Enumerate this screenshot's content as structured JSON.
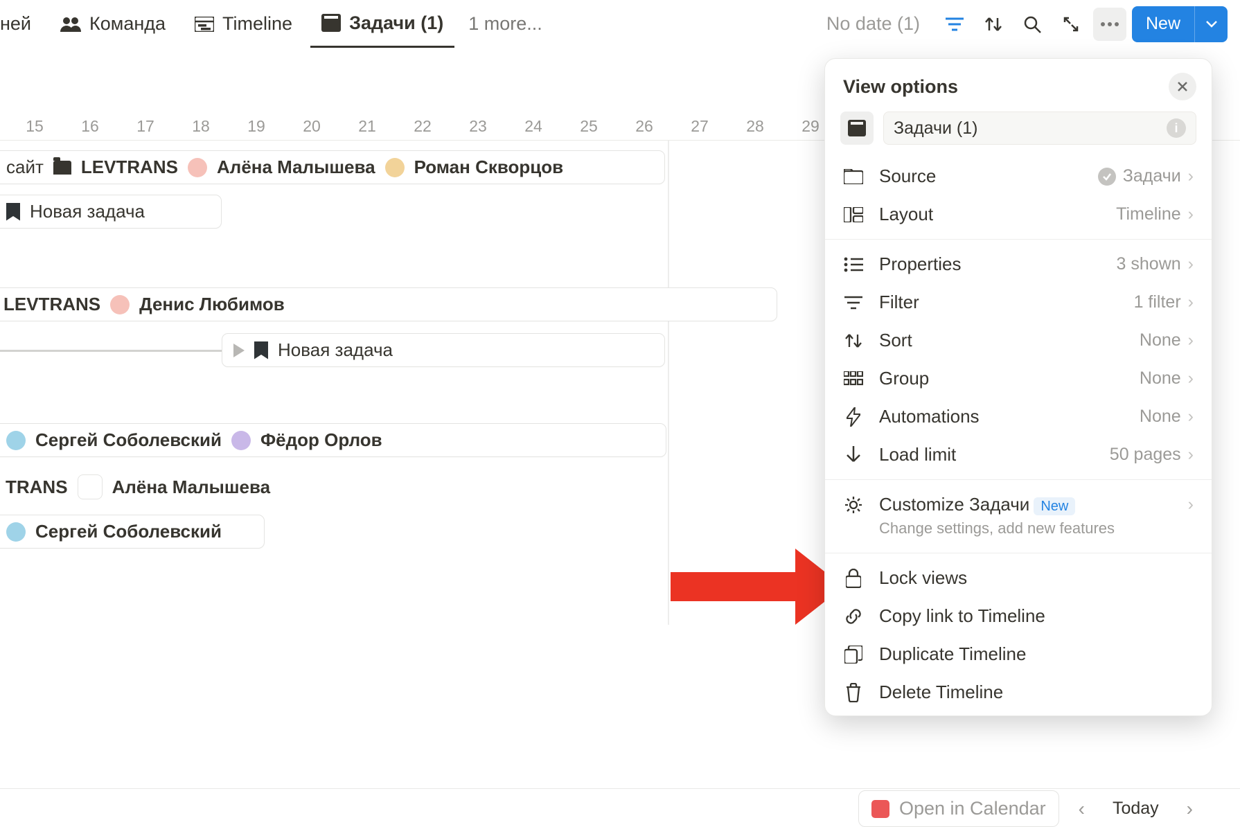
{
  "toolbar": {
    "tabs": [
      {
        "label": "ней"
      },
      {
        "label": "Команда",
        "icon": "people-icon"
      },
      {
        "label": "Timeline",
        "icon": "timeline-icon"
      },
      {
        "label": "Задачи (1)",
        "icon": "board-icon",
        "active": true
      }
    ],
    "more_label": "1 more...",
    "no_date_label": "No date (1)",
    "new_label": "New"
  },
  "calendar": {
    "open_label": "Open in Calend",
    "open_label_bottom": "Open in Calendar",
    "dates": [
      "15",
      "16",
      "17",
      "18",
      "19",
      "20",
      "21",
      "22",
      "23",
      "24",
      "25",
      "26",
      "27",
      "28",
      "29"
    ],
    "today_label": "Today"
  },
  "timeline": {
    "cards": [
      {
        "id": "c1",
        "text_prefix": "сайт",
        "folder_label": "LEVTRANS",
        "people": [
          {
            "name": "Алёна Малышева",
            "av": "av-a"
          },
          {
            "name": "Роман Скворцов",
            "av": "av-b"
          }
        ]
      },
      {
        "id": "c2",
        "bookmark": true,
        "text": "Новая задача"
      },
      {
        "id": "c3",
        "folder_leading": true,
        "folder_label": "LEVTRANS",
        "people": [
          {
            "name": "Денис Любимов",
            "av": "av-a"
          }
        ]
      },
      {
        "id": "c4",
        "play": true,
        "bookmark": true,
        "text": "Новая задача"
      },
      {
        "id": "c5",
        "people": [
          {
            "name": "Сергей Соболевский",
            "av": "av-c"
          },
          {
            "name": "Фёдор Орлов",
            "av": "av-d"
          }
        ]
      },
      {
        "id": "c6",
        "text_prefix": "TRANS",
        "people": [
          {
            "name": "Алёна Малышева",
            "av": "av-a"
          }
        ]
      },
      {
        "id": "c7",
        "people": [
          {
            "name": "Сергей Соболевский",
            "av": "av-c"
          }
        ]
      }
    ]
  },
  "panel": {
    "title": "View options",
    "view_name": "Задачи (1)",
    "rows": {
      "source": {
        "label": "Source",
        "value": "Задачи"
      },
      "layout": {
        "label": "Layout",
        "value": "Timeline"
      },
      "properties": {
        "label": "Properties",
        "value": "3 shown"
      },
      "filter": {
        "label": "Filter",
        "value": "1 filter"
      },
      "sort": {
        "label": "Sort",
        "value": "None"
      },
      "group": {
        "label": "Group",
        "value": "None"
      },
      "automations": {
        "label": "Automations",
        "value": "None"
      },
      "loadlimit": {
        "label": "Load limit",
        "value": "50 pages"
      },
      "customize": {
        "label": "Customize Задачи",
        "badge": "New",
        "sub": "Change settings, add new features"
      },
      "lock": {
        "label": "Lock views"
      },
      "copy": {
        "label": "Copy link to Timeline"
      },
      "duplicate": {
        "label": "Duplicate Timeline"
      },
      "delete": {
        "label": "Delete Timeline"
      }
    }
  }
}
